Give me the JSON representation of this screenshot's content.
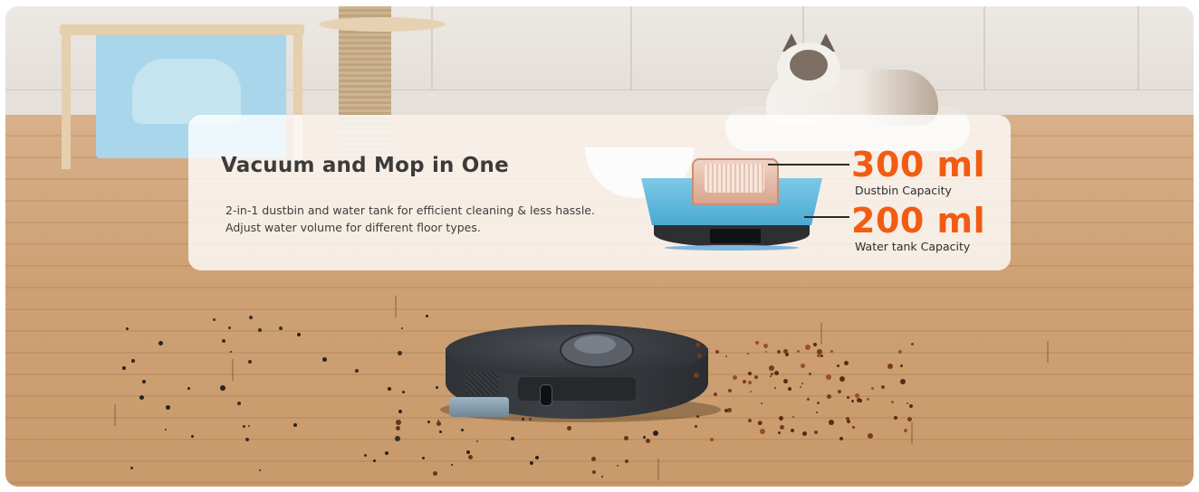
{
  "card": {
    "headline": "Vacuum and Mop in One",
    "description_lines": [
      "2-in-1 dustbin and water tank for efficient cleaning & less hassle.",
      "Adjust water volume for different floor types."
    ]
  },
  "capacities": [
    {
      "value": "300 ml",
      "label": "Dustbin Capacity"
    },
    {
      "value": "200 ml",
      "label": "Water tank Capacity"
    }
  ],
  "colors": {
    "accent": "#f25c12",
    "headline": "#3b3b3b",
    "card_background": "rgba(255,255,255,0.80)"
  }
}
